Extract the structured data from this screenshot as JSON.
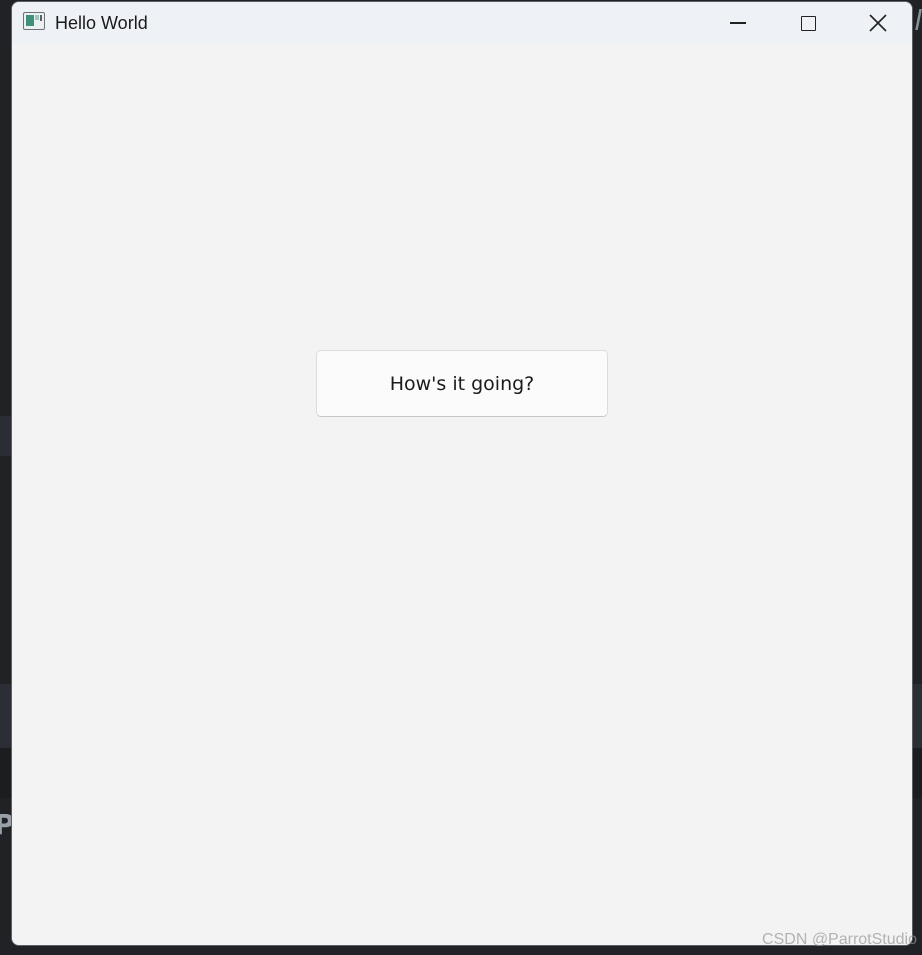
{
  "window": {
    "title": "Hello World",
    "icon": "app-window-icon",
    "controls": {
      "minimize_icon": "minimize-icon",
      "maximize_icon": "maximize-icon",
      "close_icon": "close-icon"
    }
  },
  "main": {
    "button_label": "How's it going?"
  },
  "watermark": {
    "text": "CSDN @ParrotStudio"
  },
  "colors": {
    "window_bg": "#f3f3f3",
    "titlebar_bg": "#eef2f7",
    "button_bg": "#fbfbfb",
    "desktop_bg": "#202226"
  }
}
